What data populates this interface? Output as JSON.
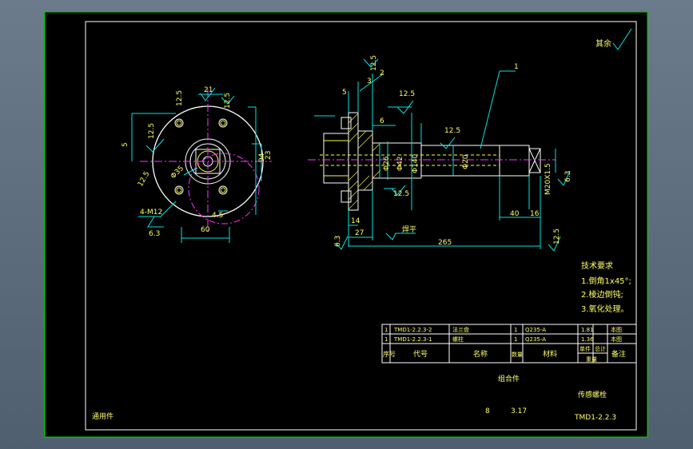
{
  "roughness_note": "其余",
  "tech": {
    "title": "技术要求",
    "items": [
      "1.倒角1x45°;",
      "2.棱边倒钝;",
      "3.氧化处理。"
    ]
  },
  "dims": {
    "d21": "21",
    "d12_5_a": "12.5",
    "d12_5_b": "12.5",
    "d12_5_c": "12.5",
    "d12_5_d": "12.5",
    "d5": "5",
    "d23": "23",
    "d94": "94",
    "phi35": "Φ35",
    "d4_5": "4.5",
    "d60": "60",
    "m12": "4-M12",
    "d6_3_a": "6.3",
    "r12_5_top": "12.5",
    "d5b": "5",
    "d3": "3",
    "d2": "2",
    "r12_5_mid": "12.5",
    "d6": "6",
    "r12_5_shaft": "12.5",
    "phi26": "Φ26",
    "phi42": "Φ42",
    "phi140": "Φ140",
    "phi20": "Φ20",
    "d1": "1",
    "m20": "M20X1.5",
    "d6_3_b": "6.3",
    "r12_5_low": "12.5",
    "d40": "40",
    "d16": "16",
    "d14": "14",
    "d27": "27",
    "weld": "焊平",
    "d6_3_c": "6.3",
    "d265": "265",
    "r12_5_end": "12.5"
  },
  "bom": {
    "rows": [
      [
        "1",
        "TMD1-2.2.3-2",
        "法兰盘",
        "1",
        "Q235-A",
        "1.81",
        "本图"
      ],
      [
        "1",
        "TMD1-2.2.3-1",
        "螺柱",
        "1",
        "Q235-A",
        "1.36",
        "本图"
      ]
    ],
    "headers": [
      "序号",
      "代号",
      "名称",
      "数量",
      "材料",
      "单件",
      "总计",
      "备注"
    ],
    "weight": "重量"
  },
  "title_block": {
    "type": "组合件",
    "name": "传感螺栓",
    "scale": "8",
    "sheet": "3.17",
    "code": "TMD1-2.2.3"
  },
  "footer": "通用件",
  "colors": {
    "line": "#ffffff",
    "dim": "#00e5e5",
    "center": "#ff33ff",
    "hidden": "#ffff33",
    "hatch": "#ffff33",
    "green": "#00c400",
    "text": "#ffff66"
  }
}
